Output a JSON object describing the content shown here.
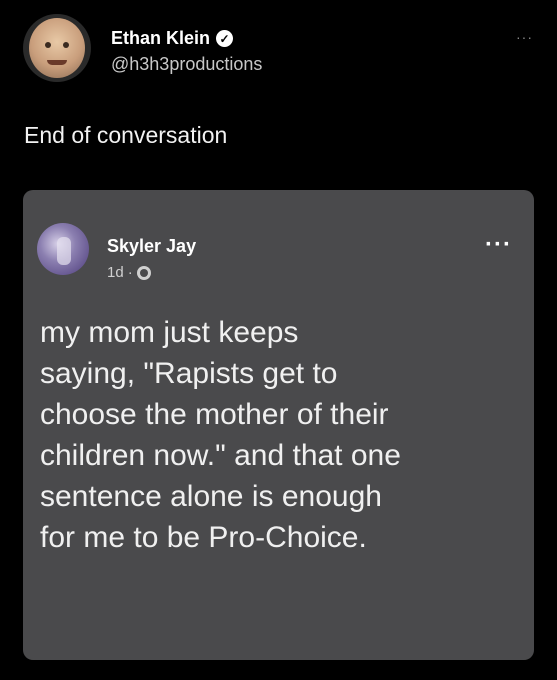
{
  "tweet": {
    "author_name": "Ethan Klein",
    "author_handle": "@h3h3productions",
    "more_label": "···",
    "text": "End of conversation"
  },
  "embedded_post": {
    "author_name": "Skyler Jay",
    "timestamp": "1d",
    "separator": "·",
    "privacy_icon": "globe-icon",
    "more_label": "···",
    "body": "my mom just keeps\nsaying, \"Rapists get to\nchoose the mother of their\nchildren now.\" and that one\nsentence alone is enough\nfor me to be Pro-Choice."
  },
  "colors": {
    "background": "#000000",
    "card_background": "#4a4a4c"
  }
}
